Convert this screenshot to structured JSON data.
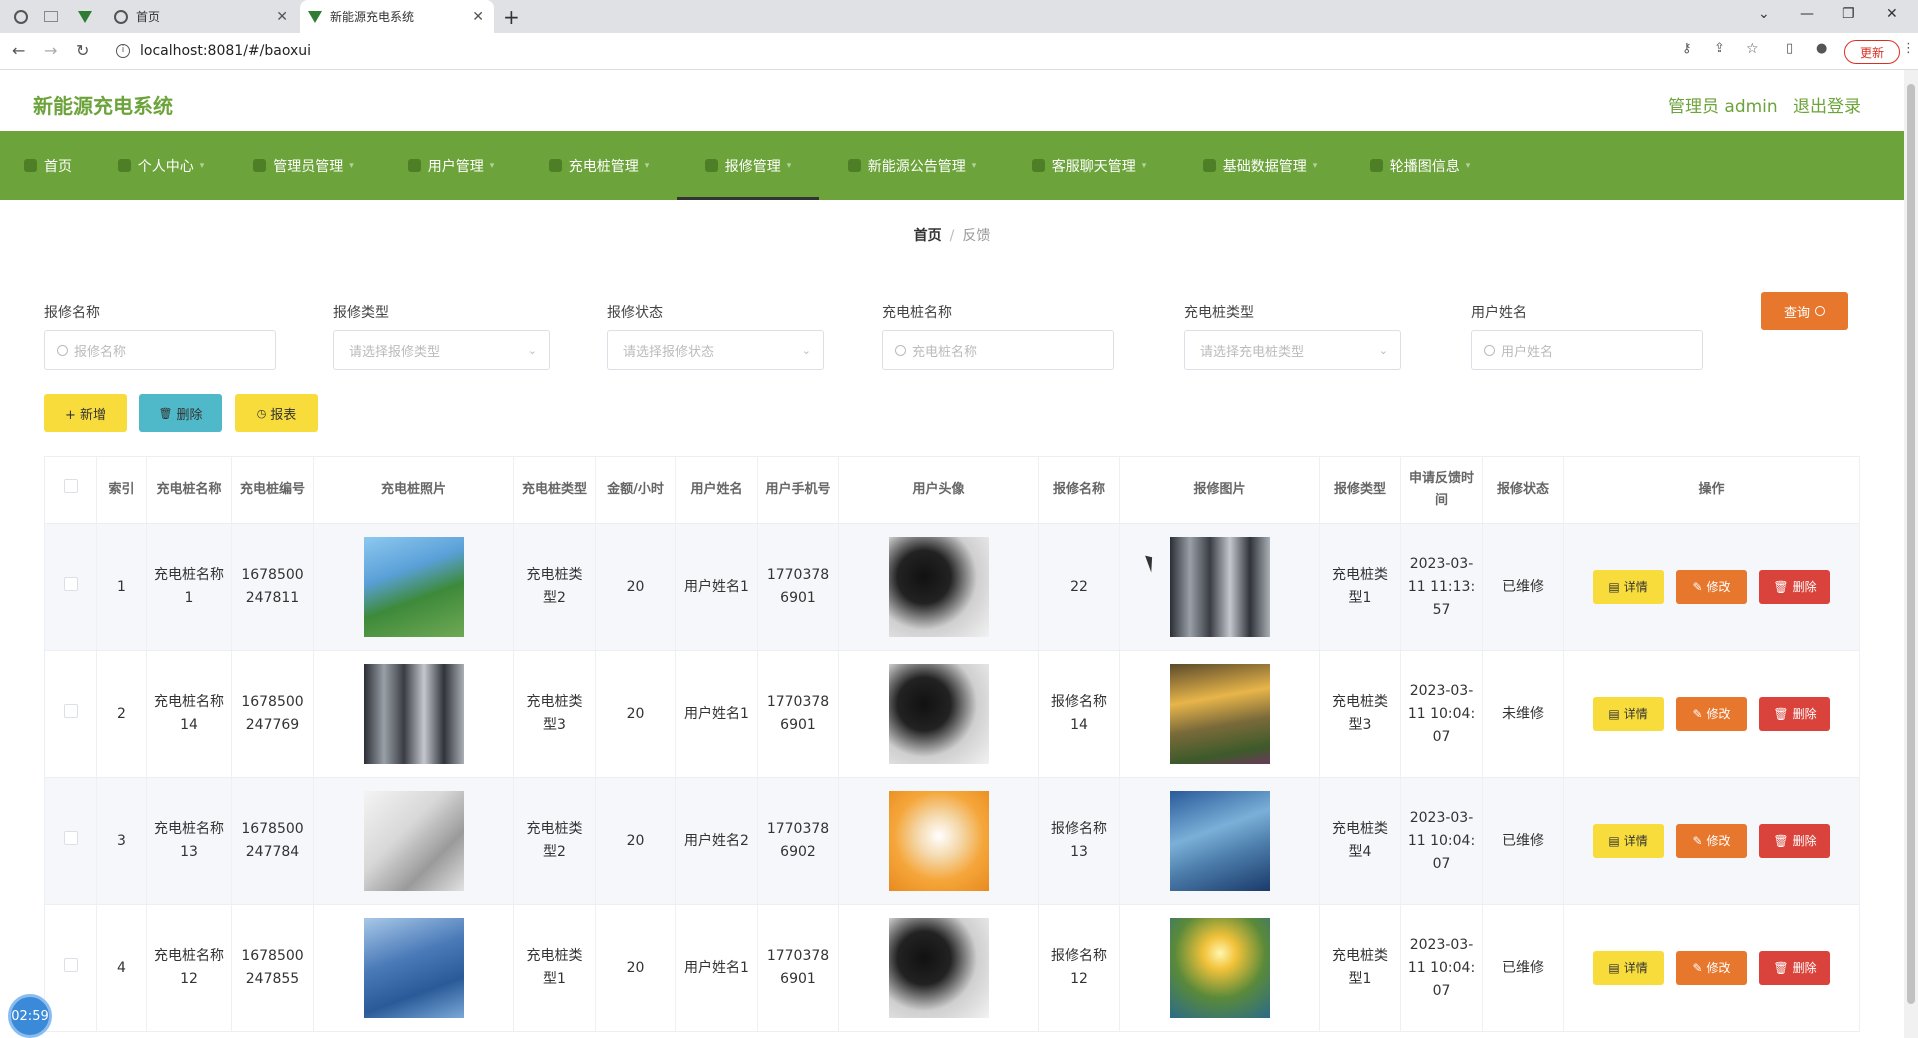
{
  "browser": {
    "tabs": [
      {
        "label": ""
      },
      {
        "label": ""
      },
      {
        "label": ""
      },
      {
        "label": "首页"
      },
      {
        "label": "新能源充电系统"
      }
    ],
    "url": "localhost:8081/#/baoxui",
    "update_label": "更新"
  },
  "header": {
    "title": "新能源充电系统",
    "user_label": "管理员 admin",
    "logout_label": "退出登录"
  },
  "menu": [
    {
      "label": "首页",
      "icon": "home-icon"
    },
    {
      "label": "个人中心",
      "icon": "user-icon"
    },
    {
      "label": "管理员管理",
      "icon": "admin-icon"
    },
    {
      "label": "用户管理",
      "icon": "users-icon"
    },
    {
      "label": "充电桩管理",
      "icon": "charger-icon"
    },
    {
      "label": "报修管理",
      "icon": "repair-icon"
    },
    {
      "label": "新能源公告管理",
      "icon": "notice-icon"
    },
    {
      "label": "客服聊天管理",
      "icon": "chat-icon"
    },
    {
      "label": "基础数据管理",
      "icon": "data-icon"
    },
    {
      "label": "轮播图信息",
      "icon": "image-icon"
    }
  ],
  "breadcrumb": {
    "home": "首页",
    "current": "反馈"
  },
  "filters": {
    "repair_name_label": "报修名称",
    "repair_name_placeholder": "报修名称",
    "repair_type_label": "报修类型",
    "repair_type_placeholder": "请选择报修类型",
    "repair_status_label": "报修状态",
    "repair_status_placeholder": "请选择报修状态",
    "charger_name_label": "充电桩名称",
    "charger_name_placeholder": "充电桩名称",
    "charger_type_label": "充电桩类型",
    "charger_type_placeholder": "请选择充电桩类型",
    "user_name_label": "用户姓名",
    "user_name_placeholder": "用户姓名",
    "query_label": "查询"
  },
  "actions": {
    "add": "+ 新增",
    "delete": "删除",
    "report": "报表"
  },
  "table": {
    "headers": [
      "索引",
      "充电桩名称",
      "充电桩编号",
      "充电桩照片",
      "充电桩类型",
      "金额/小时",
      "用户姓名",
      "用户手机号",
      "用户头像",
      "报修名称",
      "报修图片",
      "报修类型",
      "申请反馈时间",
      "报修状态",
      "操作"
    ],
    "op_detail": "详情",
    "op_edit": "修改",
    "op_delete": "删除",
    "rows": [
      {
        "index": "1",
        "name": "充电桩名称1",
        "code": "1678500247811",
        "type": "充电桩类型2",
        "price": "20",
        "user": "用户姓名1",
        "phone": "17703786901",
        "repair_name": "22",
        "repair_type": "充电桩类型1",
        "time": "2023-03-11 11:13:57",
        "status": "已维修"
      },
      {
        "index": "2",
        "name": "充电桩名称14",
        "code": "1678500247769",
        "type": "充电桩类型3",
        "price": "20",
        "user": "用户姓名1",
        "phone": "17703786901",
        "repair_name": "报修名称14",
        "repair_type": "充电桩类型3",
        "time": "2023-03-11 10:04:07",
        "status": "未维修"
      },
      {
        "index": "3",
        "name": "充电桩名称13",
        "code": "1678500247784",
        "type": "充电桩类型2",
        "price": "20",
        "user": "用户姓名2",
        "phone": "17703786902",
        "repair_name": "报修名称13",
        "repair_type": "充电桩类型4",
        "time": "2023-03-11 10:04:07",
        "status": "已维修"
      },
      {
        "index": "4",
        "name": "充电桩名称12",
        "code": "1678500247855",
        "type": "充电桩类型1",
        "price": "20",
        "user": "用户姓名1",
        "phone": "17703786901",
        "repair_name": "报修名称12",
        "repair_type": "充电桩类型1",
        "time": "2023-03-11 10:04:07",
        "status": "已维修"
      }
    ]
  },
  "timer": "02:59"
}
